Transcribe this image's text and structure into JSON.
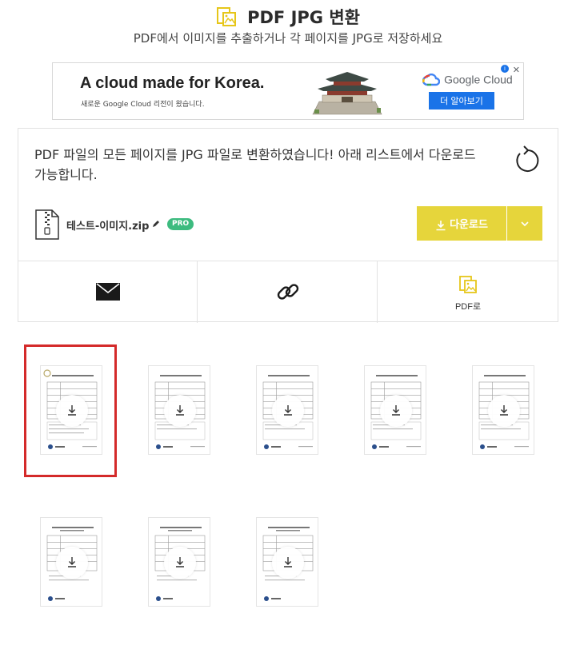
{
  "header": {
    "title": "PDF JPG 변환",
    "subtitle": "PDF에서 이미지를 추출하거나 각 페이지를 JPG로 저장하세요",
    "accent": "#e6c619"
  },
  "ad": {
    "headline": "A cloud made for Korea.",
    "sub": "새로운 Google Cloud 리전이 왔습니다.",
    "logo_text": "Google Cloud",
    "cta": "더 알아보기",
    "close": "✕",
    "info": "i"
  },
  "result": {
    "message": "PDF 파일의 모든 페이지를 JPG 파일로 변환하였습니다! 아래 리스트에서 다운로드 가능합니다.",
    "file_name": "테스트-이미지.zip",
    "badge": "PRO",
    "download_label": "다운로드",
    "download_color": "#e6d53b"
  },
  "actions": [
    {
      "name": "email",
      "label": ""
    },
    {
      "name": "link",
      "label": ""
    },
    {
      "name": "pdf",
      "label": "PDF로"
    }
  ],
  "thumbnails": [
    {
      "page": 1,
      "selected": true
    },
    {
      "page": 2,
      "selected": false
    },
    {
      "page": 3,
      "selected": false
    },
    {
      "page": 4,
      "selected": false
    },
    {
      "page": 5,
      "selected": false
    },
    {
      "page": 6,
      "selected": false
    },
    {
      "page": 7,
      "selected": false
    },
    {
      "page": 8,
      "selected": false
    }
  ],
  "colors": {
    "highlight": "#d42a2a",
    "pro": "#3dbb7f"
  }
}
